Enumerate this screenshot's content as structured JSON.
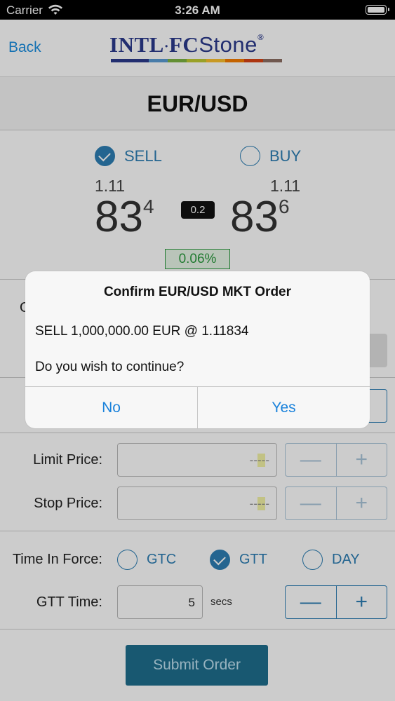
{
  "status_bar": {
    "carrier": "Carrier",
    "time": "3:26 AM"
  },
  "nav": {
    "back_label": "Back",
    "logo": {
      "intl": "INTL",
      "separator": "·",
      "fc": "FC",
      "stone": "Stone",
      "reg": "®"
    }
  },
  "pair": "EUR/USD",
  "side": {
    "sell_label": "SELL",
    "buy_label": "BUY",
    "selected": "SELL"
  },
  "prices": {
    "sell": {
      "prefix": "1.11",
      "big": "83",
      "pip": "4"
    },
    "buy": {
      "prefix": "1.11",
      "big": "83",
      "pip": "6"
    },
    "spread": "0.2",
    "change": "0.06%"
  },
  "form": {
    "order_type_label_partial": "O",
    "limit_price_label": "Limit Price:",
    "stop_price_label": "Stop Price:",
    "price_placeholder": {
      "pre": "--",
      "mid": "--",
      "post": "-"
    },
    "time_in_force_label": "Time In Force:",
    "tif_options": [
      "GTC",
      "GTT",
      "DAY"
    ],
    "tif_selected": "GTT",
    "gtt_time_label": "GTT Time:",
    "gtt_time_value": "5",
    "gtt_unit": "secs",
    "minus": "—",
    "plus": "+",
    "submit_label": "Submit Order"
  },
  "alert": {
    "title": "Confirm EUR/USD  MKT Order",
    "line1": "SELL 1,000,000.00 EUR @ 1.11834",
    "line2": "Do you wish to continue?",
    "no_label": "No",
    "yes_label": "Yes"
  },
  "colors": {
    "accent": "#2d7fb4",
    "link": "#1a8ee0",
    "positive": "#2a9a3e",
    "logo_blue": "#2b3a8c",
    "submit_bg": "#1f6e8e"
  }
}
